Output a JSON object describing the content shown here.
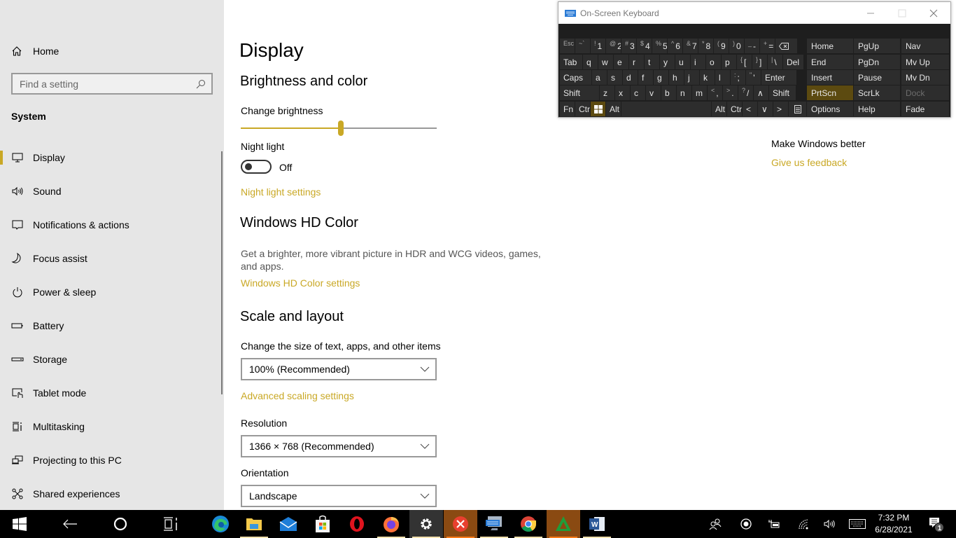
{
  "sidebar": {
    "home_label": "Home",
    "search_placeholder": "Find a setting",
    "section_title": "System",
    "items": [
      {
        "label": "Display",
        "icon": "monitor-icon",
        "active": true
      },
      {
        "label": "Sound",
        "icon": "speaker-icon"
      },
      {
        "label": "Notifications & actions",
        "icon": "notification-icon"
      },
      {
        "label": "Focus assist",
        "icon": "moon-icon"
      },
      {
        "label": "Power & sleep",
        "icon": "power-icon"
      },
      {
        "label": "Battery",
        "icon": "battery-icon"
      },
      {
        "label": "Storage",
        "icon": "storage-icon"
      },
      {
        "label": "Tablet mode",
        "icon": "tablet-mode-icon"
      },
      {
        "label": "Multitasking",
        "icon": "multitasking-icon"
      },
      {
        "label": "Projecting to this PC",
        "icon": "projecting-icon"
      },
      {
        "label": "Shared experiences",
        "icon": "shared-experiences-icon"
      }
    ]
  },
  "main": {
    "page_title": "Display",
    "brightness_section": "Brightness and color",
    "brightness_label": "Change brightness",
    "brightness_value_percent": 51,
    "night_light_label": "Night light",
    "night_light_state": "Off",
    "night_light_settings_link": "Night light settings",
    "hd_color_section": "Windows HD Color",
    "hd_color_desc": "Get a brighter, more vibrant picture in HDR and WCG videos, games, and apps.",
    "hd_color_link": "Windows HD Color settings",
    "scale_section": "Scale and layout",
    "scale_label": "Change the size of text, apps, and other items",
    "scale_value": "100% (Recommended)",
    "advanced_scaling_link": "Advanced scaling settings",
    "resolution_label": "Resolution",
    "resolution_value": "1366 × 768 (Recommended)",
    "orientation_label": "Orientation",
    "orientation_value": "Landscape",
    "feedback_heading": "Make Windows better",
    "feedback_link": "Give us feedback"
  },
  "osk": {
    "title": "On-Screen Keyboard",
    "rows": [
      [
        [
          "Esc",
          "esc"
        ],
        [
          "~`",
          ""
        ],
        [
          "!",
          "1"
        ],
        [
          "@",
          "2"
        ],
        [
          "#",
          "3"
        ],
        [
          "$",
          "4"
        ],
        [
          "%",
          "5"
        ],
        [
          "^",
          "6"
        ],
        [
          "&",
          "7"
        ],
        [
          "*",
          "8"
        ],
        [
          "(",
          "9"
        ],
        [
          ")",
          "0"
        ],
        [
          "_",
          "-"
        ],
        [
          "+",
          "="
        ],
        [
          "",
          "⌫"
        ]
      ],
      [
        [
          "",
          "Tab"
        ],
        [
          "",
          "q"
        ],
        [
          "",
          "w"
        ],
        [
          "",
          "e"
        ],
        [
          "",
          "r"
        ],
        [
          "",
          "t"
        ],
        [
          "",
          "y"
        ],
        [
          "",
          "u"
        ],
        [
          "",
          "i"
        ],
        [
          "",
          "o"
        ],
        [
          "",
          "p"
        ],
        [
          "{",
          "["
        ],
        [
          "}",
          "]"
        ],
        [
          "|",
          "\\"
        ],
        [
          "",
          "Del"
        ]
      ],
      [
        [
          "",
          "Caps"
        ],
        [
          "",
          "a"
        ],
        [
          "",
          "s"
        ],
        [
          "",
          "d"
        ],
        [
          "",
          "f"
        ],
        [
          "",
          "g"
        ],
        [
          "",
          "h"
        ],
        [
          "",
          "j"
        ],
        [
          "",
          "k"
        ],
        [
          "",
          "l"
        ],
        [
          ":",
          ";"
        ],
        [
          "\"",
          "'"
        ],
        [
          "",
          "Enter"
        ]
      ],
      [
        [
          "",
          "Shift"
        ],
        [
          "",
          "z"
        ],
        [
          "",
          "x"
        ],
        [
          "",
          "c"
        ],
        [
          "",
          "v"
        ],
        [
          "",
          "b"
        ],
        [
          "",
          "n"
        ],
        [
          "",
          "m"
        ],
        [
          "<",
          ","
        ],
        [
          ">",
          "."
        ],
        [
          "?",
          "/"
        ],
        [
          "",
          "∧"
        ],
        [
          "",
          "Shift"
        ]
      ],
      [
        [
          "",
          "Fn"
        ],
        [
          "",
          "Ctrl"
        ],
        [
          "",
          "Win"
        ],
        [
          "",
          "Alt"
        ],
        [
          "",
          ""
        ],
        [
          "",
          "Alt"
        ],
        [
          "",
          "Ctrl"
        ],
        [
          "",
          "<"
        ],
        [
          "",
          "∨"
        ],
        [
          "",
          ">"
        ],
        [
          "",
          "Menu"
        ]
      ]
    ],
    "nav_keys": [
      [
        "Home",
        "PgUp",
        "Nav"
      ],
      [
        "End",
        "PgDn",
        "Mv Up"
      ],
      [
        "Insert",
        "Pause",
        "Mv Dn"
      ],
      [
        "PrtScn",
        "ScrLk",
        "Dock"
      ],
      [
        "Options",
        "Help",
        "Fade"
      ]
    ],
    "highlighted_keys": [
      "Win",
      "PrtScn"
    ],
    "disabled_keys": [
      "Dock"
    ]
  },
  "taskbar": {
    "apps": [
      "Start",
      "Back",
      "Cortana",
      "Task View",
      "Microsoft Edge",
      "File Explorer",
      "Mail",
      "Microsoft Store",
      "Opera",
      "Firefox",
      "Settings",
      "Close app",
      "On-Screen Keyboard",
      "Google Chrome",
      "App",
      "Microsoft Word"
    ],
    "time": "7:32 PM",
    "date": "6/28/2021",
    "notification_count": "1"
  },
  "colors": {
    "accent": "#c9a825",
    "sidebar_bg": "#e6e6e6",
    "osk_bg": "#1e1e1e",
    "osk_key": "#2d2d2d",
    "osk_highlight": "#5c4a10"
  }
}
